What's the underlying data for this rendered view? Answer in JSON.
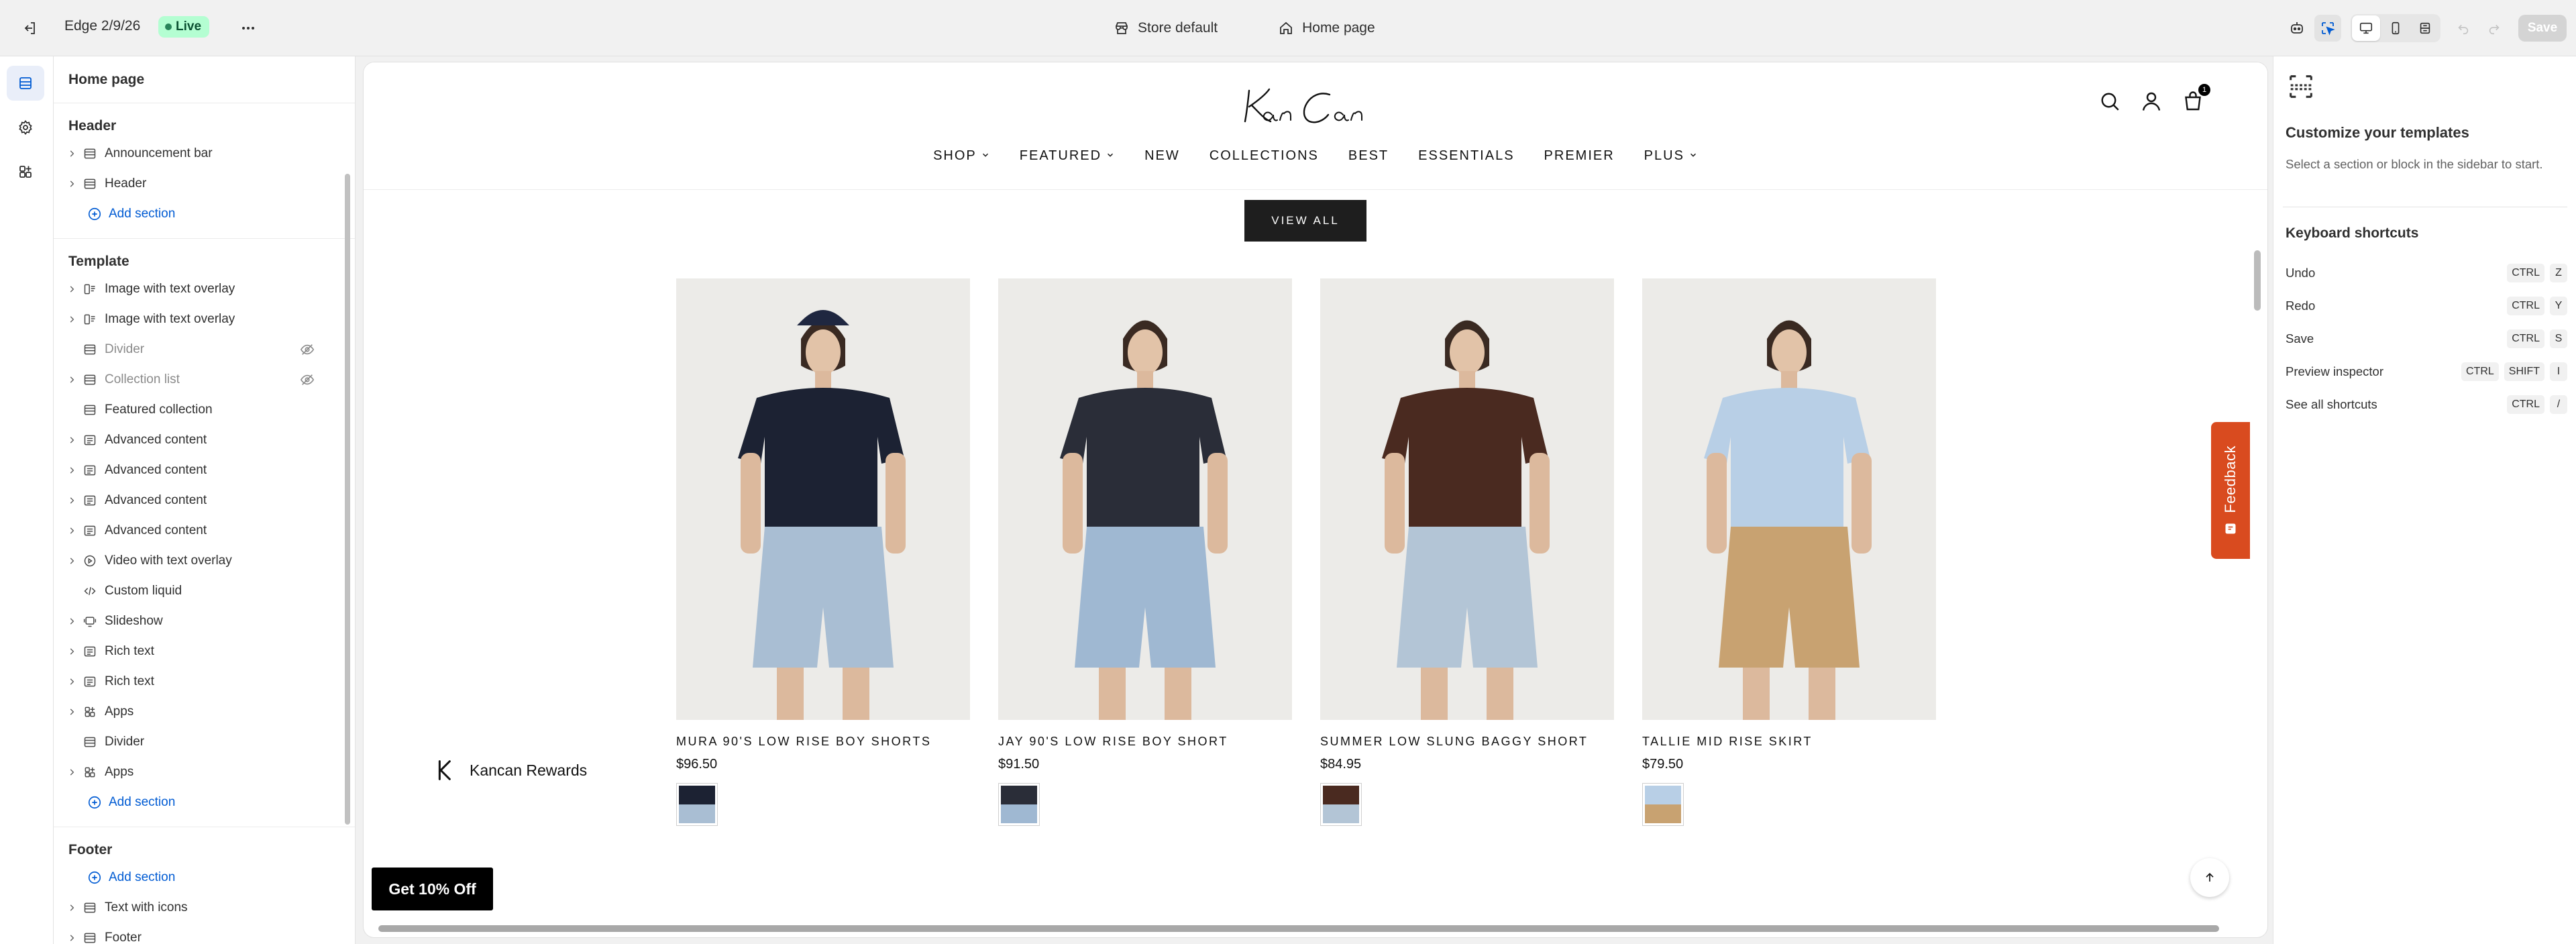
{
  "topbar": {
    "theme_name": "Edge 2/9/26",
    "status_badge": "Live",
    "store_selector": "Store default",
    "page_selector": "Home page",
    "save_label": "Save"
  },
  "sidebar": {
    "title": "Home page",
    "header_group": {
      "title": "Header",
      "items": [
        {
          "label": "Announcement bar"
        },
        {
          "label": "Header"
        }
      ],
      "add_label": "Add section"
    },
    "template_group": {
      "title": "Template",
      "items": [
        {
          "label": "Image with text overlay",
          "icon": "image-text-icon",
          "expandable": true,
          "hidden": false
        },
        {
          "label": "Image with text overlay",
          "icon": "image-text-icon",
          "expandable": true,
          "hidden": false
        },
        {
          "label": "Divider",
          "icon": "section-icon",
          "expandable": false,
          "hidden": true
        },
        {
          "label": "Collection list",
          "icon": "section-icon",
          "expandable": true,
          "hidden": true
        },
        {
          "label": "Featured collection",
          "icon": "section-icon",
          "expandable": false,
          "hidden": false
        },
        {
          "label": "Advanced content",
          "icon": "content-icon",
          "expandable": true,
          "hidden": false
        },
        {
          "label": "Advanced content",
          "icon": "content-icon",
          "expandable": true,
          "hidden": false
        },
        {
          "label": "Advanced content",
          "icon": "content-icon",
          "expandable": true,
          "hidden": false
        },
        {
          "label": "Advanced content",
          "icon": "content-icon",
          "expandable": true,
          "hidden": false
        },
        {
          "label": "Video with text overlay",
          "icon": "play-icon",
          "expandable": true,
          "hidden": false
        },
        {
          "label": "Custom liquid",
          "icon": "code-icon",
          "expandable": false,
          "hidden": false
        },
        {
          "label": "Slideshow",
          "icon": "slideshow-icon",
          "expandable": true,
          "hidden": false
        },
        {
          "label": "Rich text",
          "icon": "content-icon",
          "expandable": true,
          "hidden": false
        },
        {
          "label": "Rich text",
          "icon": "content-icon",
          "expandable": true,
          "hidden": false
        },
        {
          "label": "Apps",
          "icon": "apps-icon",
          "expandable": true,
          "hidden": false
        },
        {
          "label": "Divider",
          "icon": "section-icon",
          "expandable": false,
          "hidden": false
        },
        {
          "label": "Apps",
          "icon": "apps-icon",
          "expandable": true,
          "hidden": false
        }
      ],
      "add_label": "Add section"
    },
    "footer_group": {
      "title": "Footer",
      "add_label": "Add section",
      "items": [
        {
          "label": "Text with icons"
        },
        {
          "label": "Footer"
        }
      ]
    }
  },
  "preview": {
    "logo_text": "Kancan",
    "nav": [
      {
        "label": "SHOP",
        "dropdown": true
      },
      {
        "label": "FEATURED",
        "dropdown": true
      },
      {
        "label": "NEW",
        "dropdown": false
      },
      {
        "label": "COLLECTIONS",
        "dropdown": false
      },
      {
        "label": "BEST",
        "dropdown": false
      },
      {
        "label": "ESSENTIALS",
        "dropdown": false
      },
      {
        "label": "PREMIER",
        "dropdown": false
      },
      {
        "label": "PLUS",
        "dropdown": true
      }
    ],
    "cart_count": "1",
    "view_all_label": "VIEW ALL",
    "products": [
      {
        "name": "MURA 90'S LOW RISE BOY SHORTS",
        "price": "$96.50",
        "top_color": "#1c2233",
        "bottom_color": "#a9bed3",
        "has_cap": true
      },
      {
        "name": "JAY 90'S LOW RISE BOY SHORT",
        "price": "$91.50",
        "top_color": "#2a2d38",
        "bottom_color": "#9fb8d2",
        "has_cap": false
      },
      {
        "name": "SUMMER LOW SLUNG BAGGY SHORT",
        "price": "$84.95",
        "top_color": "#4a2a20",
        "bottom_color": "#b3c5d6",
        "has_cap": false
      },
      {
        "name": "TALLIE MID RISE SKIRT",
        "price": "$79.50",
        "top_color": "#b8cfe6",
        "bottom_color": "#c8a271",
        "has_cap": false
      }
    ],
    "rewards_label": "Kancan Rewards",
    "promo_label": "Get 10% Off",
    "feedback_label": "Feedback"
  },
  "inspector": {
    "title": "Customize your templates",
    "description": "Select a section or block in the sidebar to start.",
    "shortcuts_title": "Keyboard shortcuts",
    "shortcuts": [
      {
        "label": "Undo",
        "keys": [
          "CTRL",
          "Z"
        ]
      },
      {
        "label": "Redo",
        "keys": [
          "CTRL",
          "Y"
        ]
      },
      {
        "label": "Save",
        "keys": [
          "CTRL",
          "S"
        ]
      },
      {
        "label": "Preview inspector",
        "keys": [
          "CTRL",
          "SHIFT",
          "I"
        ]
      },
      {
        "label": "See all shortcuts",
        "keys": [
          "CTRL",
          "/"
        ]
      }
    ]
  },
  "colors": {
    "live_badge_bg": "#b4fed2",
    "link_blue": "#005bd3",
    "feedback_orange": "#d94b1f"
  }
}
